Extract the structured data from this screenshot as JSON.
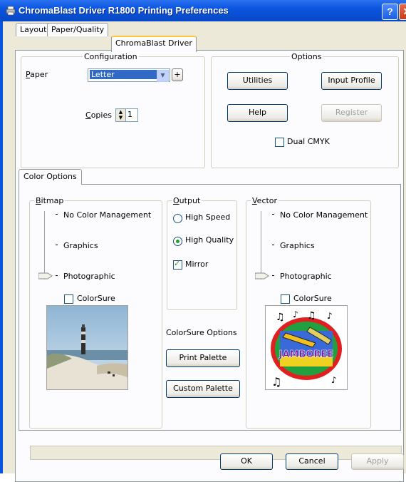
{
  "window": {
    "title": "ChromaBlast Driver R1800 Printing Preferences"
  },
  "tabs": [
    {
      "label": "Layout"
    },
    {
      "label": "Paper/Quality"
    },
    {
      "label": "ChromaBlast Driver",
      "active": true
    }
  ],
  "configuration": {
    "group_label": "Configuration",
    "paper_label": "Paper",
    "paper_value": "Letter",
    "plus_label": "+",
    "copies_label": "Copies",
    "copies_value": "1"
  },
  "options": {
    "group_label": "Options",
    "utilities_label": "Utilities",
    "input_profile_label": "Input Profile",
    "help_label": "Help",
    "register_label": "Register",
    "dual_cmyk_label": "Dual CMYK",
    "dual_cmyk_checked": false
  },
  "color_options": {
    "tab_label": "Color Options",
    "bitmap": {
      "group_label": "Bitmap",
      "levels": [
        "No Color Management",
        "Graphics",
        "Photographic"
      ],
      "selected": "Photographic",
      "colorsure_label": "ColorSure",
      "colorsure_checked": false
    },
    "output": {
      "group_label": "Output",
      "options": [
        "High Speed",
        "High Quality"
      ],
      "selected": "High Quality",
      "mirror_label": "Mirror",
      "mirror_checked": true
    },
    "colorsure_options_label": "ColorSure Options",
    "print_palette_label": "Print Palette",
    "custom_palette_label": "Custom Palette",
    "vector": {
      "group_label": "Vector",
      "levels": [
        "No Color Management",
        "Graphics",
        "Photographic"
      ],
      "selected": "Photographic",
      "colorsure_label": "ColorSure",
      "colorsure_checked": false
    }
  },
  "footer": {
    "ok_label": "OK",
    "cancel_label": "Cancel",
    "apply_label": "Apply"
  },
  "colors": {
    "titlebar": "#0a55e0",
    "dialog_bg": "#ece9d8",
    "tab_highlight": "#ffc83c",
    "selection": "#316ac5",
    "check_green": "#21a121"
  }
}
